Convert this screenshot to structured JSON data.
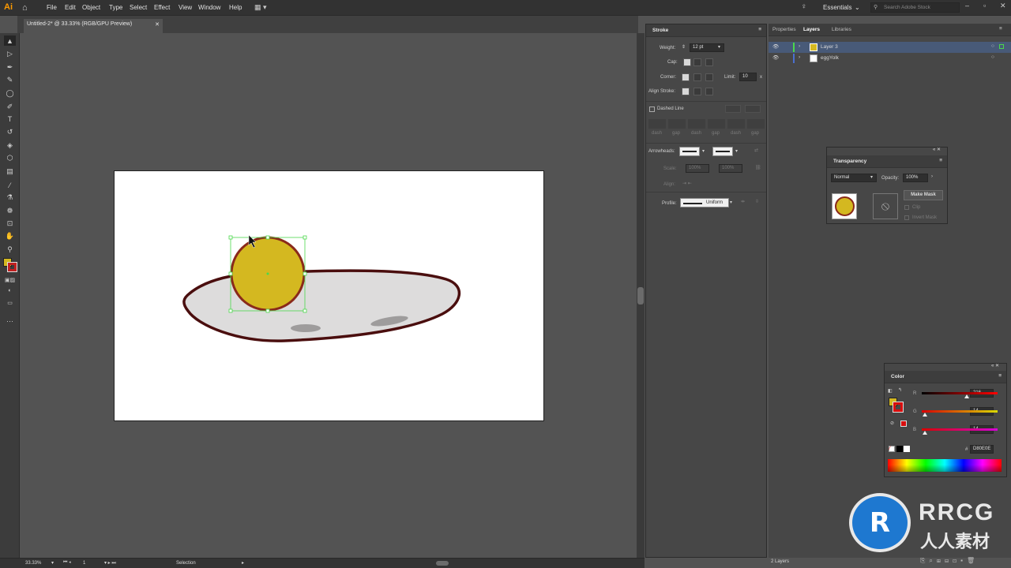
{
  "app": {
    "logo": "Ai"
  },
  "menu": {
    "items": [
      "File",
      "Edit",
      "Object",
      "Type",
      "Select",
      "Effect",
      "View",
      "Window",
      "Help"
    ],
    "workspace": "Essentials",
    "search_placeholder": "Search Adobe Stock"
  },
  "document": {
    "tab_title": "Untitled-2* @ 33.33% (RGB/GPU Preview)"
  },
  "stroke_panel": {
    "title": "Stroke",
    "weight_label": "Weight:",
    "weight_value": "12 pt",
    "cap_label": "Cap:",
    "corner_label": "Corner:",
    "limit_label": "Limit:",
    "limit_value": "10",
    "align_label": "Align Stroke:",
    "dashed_label": "Dashed Line",
    "dash_labels": [
      "dash",
      "gap",
      "dash",
      "gap",
      "dash",
      "gap"
    ],
    "arrowheads_label": "Arrowheads:",
    "scale_label": "Scale:",
    "scale_values": [
      "100%",
      "100%"
    ],
    "align2_label": "Align:",
    "profile_label": "Profile:",
    "profile_value": "Uniform"
  },
  "layers_panel": {
    "tabs": [
      "Properties",
      "Layers",
      "Libraries"
    ],
    "layers": [
      {
        "name": "Layer 3"
      },
      {
        "name": "eggYolk"
      }
    ],
    "footer": "2 Layers"
  },
  "transparency_panel": {
    "title": "Transparency",
    "mode": "Normal",
    "opacity_label": "Opacity:",
    "opacity_value": "100%",
    "make_mask": "Make Mask",
    "clip": "Clip",
    "invert_mask": "Invert Mask"
  },
  "color_panel": {
    "title": "Color",
    "channels": [
      {
        "label": "R",
        "value": "216"
      },
      {
        "label": "G",
        "value": "14"
      },
      {
        "label": "B",
        "value": "14"
      }
    ],
    "hex_label": "#",
    "hex_value": "D80E0E"
  },
  "status": {
    "zoom": "33.33%",
    "artboard": "1",
    "tool": "Selection"
  },
  "colors": {
    "yolk": "#d4b820",
    "yolk_stroke": "#8a2a1a",
    "white_fill": "#dddcdc",
    "white_stroke": "#4a0e0e",
    "selection": "#4bd84b"
  },
  "watermark": {
    "logo_text": "RRCG",
    "sub_text": "人人素材"
  }
}
